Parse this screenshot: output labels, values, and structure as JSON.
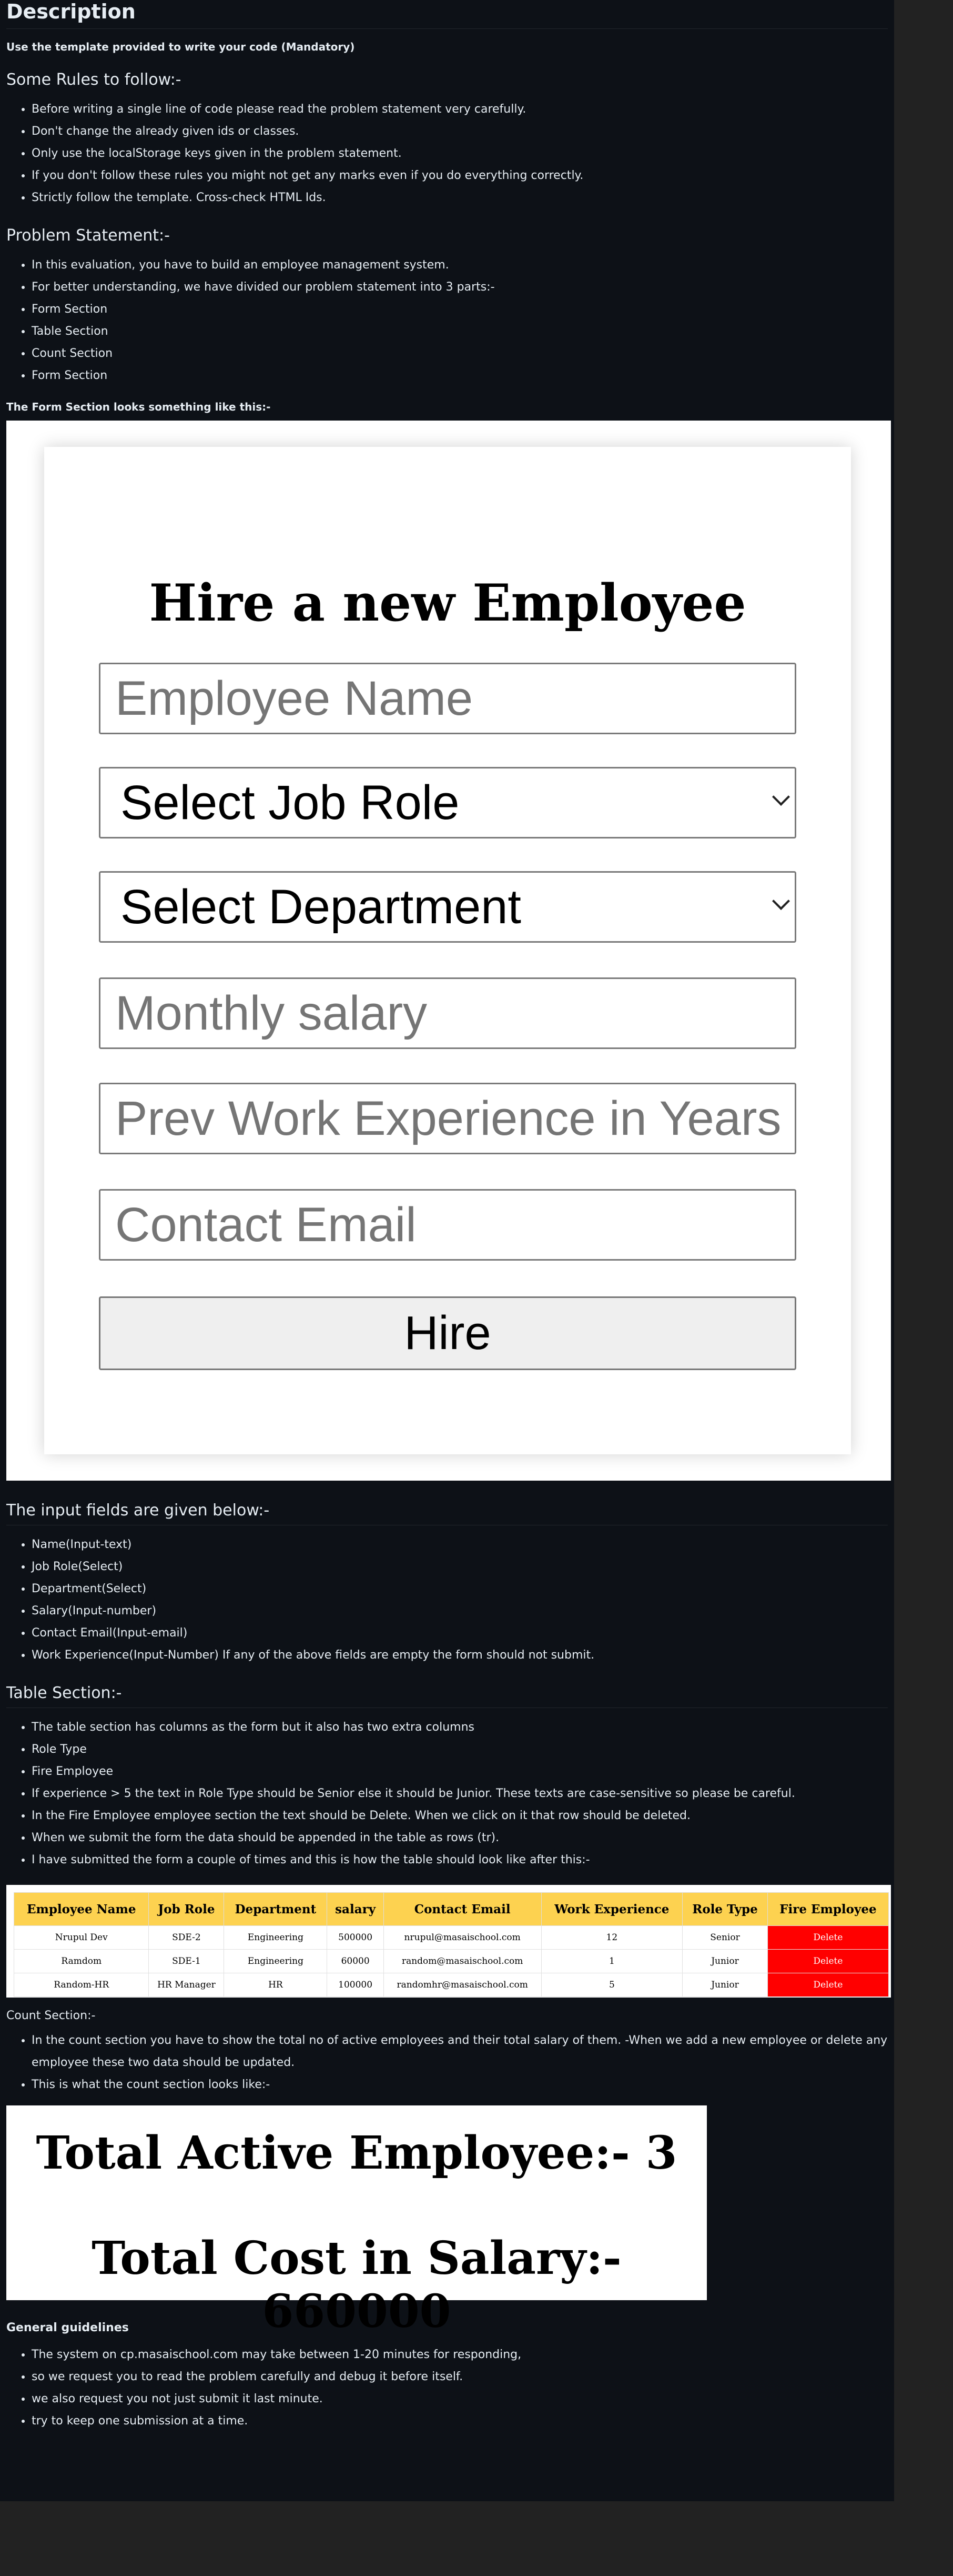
{
  "description_title": "Description",
  "template_note": "Use the template provided to write your code (Mandatory)",
  "rules": {
    "heading": "Some Rules to follow:-",
    "items": [
      "Before writing a single line of code please read the problem statement very carefully.",
      "Don't change the already given ids or classes.",
      "Only use the localStorage keys given in the problem statement.",
      "If you don't follow these rules you might not get any marks even if you do everything correctly.",
      "Strictly follow the template. Cross-check HTML Ids."
    ]
  },
  "problem": {
    "heading": "Problem Statement:-",
    "items": [
      "In this evaluation, you have to build an employee management system.",
      "For better understanding, we have divided our problem statement into 3 parts:-",
      "Form Section",
      "Table Section",
      "Count Section",
      "Form Section"
    ]
  },
  "form_intro": "The Form Section looks something like this:-",
  "form_image": {
    "title": "Hire a new Employee",
    "name_placeholder": "Employee Name",
    "job_role": "Select Job Role",
    "department": "Select Department",
    "salary_placeholder": "Monthly salary",
    "experience_placeholder": "Prev Work Experience in Years",
    "email_placeholder": "Contact Email",
    "hire_label": "Hire"
  },
  "inputs": {
    "heading": "The input fields are given below:-",
    "items": [
      "Name(Input-text)",
      "Job Role(Select)",
      "Department(Select)",
      "Salary(Input-number)",
      "Contact Email(Input-email)",
      "Work Experience(Input-Number) If any of the above fields are empty the form should not submit."
    ]
  },
  "table_section": {
    "heading": "Table Section:-",
    "items": [
      "The table section has columns as the form but it also has two extra columns",
      "Role Type",
      "Fire Employee",
      "If experience > 5 the text in Role Type should be Senior else it should be Junior. These texts are case-sensitive so please be careful.",
      "In the Fire Employee employee section the text should be Delete. When we click on it that row should be deleted.",
      "When we submit the form the data should be appended in the table as rows (tr).",
      "I have submitted the form a couple of times and this is how the table should look like after this:-"
    ]
  },
  "table_image": {
    "headers": [
      "Employee Name",
      "Job Role",
      "Department",
      "salary",
      "Contact Email",
      "Work Experience",
      "Role Type",
      "Fire Employee"
    ],
    "rows": [
      [
        "Nrupul Dev",
        "SDE-2",
        "Engineering",
        "500000",
        "nrupul@masaischool.com",
        "12",
        "Senior",
        "Delete"
      ],
      [
        "Ramdom",
        "SDE-1",
        "Engineering",
        "60000",
        "random@masaischool.com",
        "1",
        "Junior",
        "Delete"
      ],
      [
        "Random-HR",
        "HR Manager",
        "HR",
        "100000",
        "randomhr@masaischool.com",
        "5",
        "Junior",
        "Delete"
      ]
    ]
  },
  "count_section": {
    "heading": "Count Section:-",
    "items": [
      "In the count section you have to show the total no of active employees and their total salary of them. -When we add a new employee or delete any employee these two data should be updated.",
      "This is what the count section looks like:-"
    ]
  },
  "count_image": {
    "active": "Total Active Employee:- 3",
    "cost": "Total Cost in Salary:- 660000"
  },
  "guidelines": {
    "heading": "General guidelines",
    "items": [
      "The system on cp.masaischool.com may take between 1-20 minutes for responding,",
      "so we request you to read the problem carefully and debug it before itself.",
      "we also request you not just submit it last minute.",
      "try to keep one submission at a time."
    ]
  }
}
